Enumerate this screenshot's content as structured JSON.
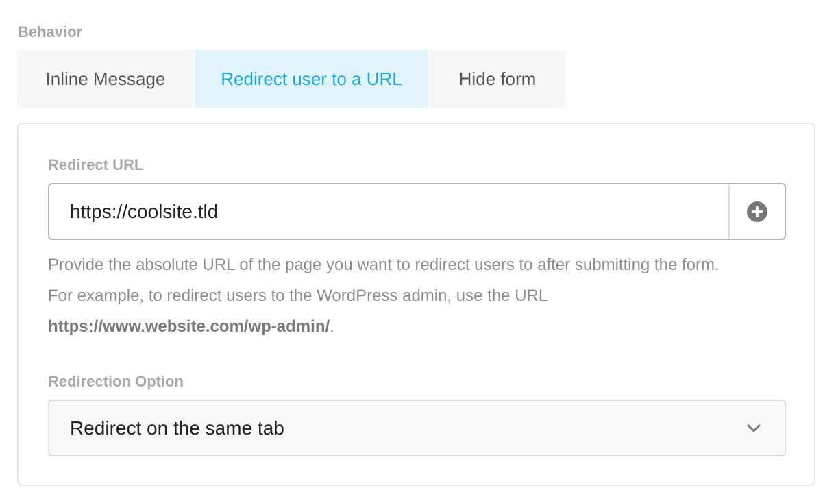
{
  "behavior": {
    "label": "Behavior",
    "tabs": [
      {
        "label": "Inline Message",
        "active": false
      },
      {
        "label": "Redirect user to a URL",
        "active": true
      },
      {
        "label": "Hide form",
        "active": false
      }
    ]
  },
  "redirect_url": {
    "label": "Redirect URL",
    "value": "https://coolsite.tld",
    "add_icon": "plus-circle-icon",
    "help_line1": "Provide the absolute URL of the page you want to redirect users to after submitting the form.",
    "help_line2": "For example, to redirect users to the WordPress admin, use the URL",
    "help_link": "https://www.website.com/wp-admin/",
    "help_suffix": "."
  },
  "redirection_option": {
    "label": "Redirection Option",
    "selected": "Redirect on the same tab",
    "icon": "chevron-down-icon"
  },
  "colors": {
    "accent": "#1fa7d6",
    "active_tab_bg": "#e1f4fb"
  }
}
